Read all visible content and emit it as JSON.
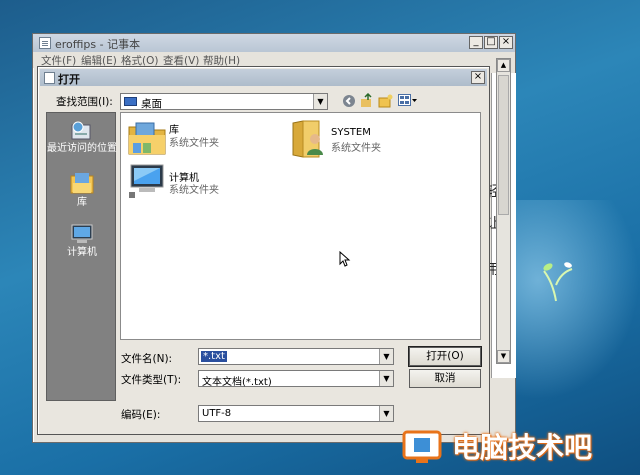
{
  "notepad": {
    "title": "eroffips - 记事本",
    "menu": [
      "文件(F)",
      "编辑(E)",
      "格式(O)",
      "查看(V)",
      "帮助(H)"
    ],
    "side_text": [
      "轻",
      "让",
      "用"
    ]
  },
  "dialog": {
    "title": "打开",
    "look_in_label": "查找范围(I):",
    "look_in_value": "桌面",
    "places": [
      {
        "label": "最近访问的位置",
        "icon": "recent-places-icon"
      },
      {
        "label": "库",
        "icon": "libraries-icon"
      },
      {
        "label": "计算机",
        "icon": "computer-icon"
      }
    ],
    "files": [
      {
        "name": "库",
        "type": "系统文件夹",
        "icon": "libraries-folder-icon"
      },
      {
        "name": "SYSTEM",
        "type": "系统文件夹",
        "icon": "user-folder-icon"
      },
      {
        "name": "计算机",
        "type": "系统文件夹",
        "icon": "computer-icon"
      }
    ],
    "filename_label": "文件名(N):",
    "filename_value": "*.txt",
    "filetype_label": "文件类型(T):",
    "filetype_value": "文本文档(*.txt)",
    "encoding_label": "编码(E):",
    "encoding_value": "UTF-8",
    "open_button": "打开(O)",
    "cancel_button": "取消"
  },
  "watermark": {
    "text": "电脑技术吧"
  },
  "colors": {
    "selection": "#2a4f9e",
    "places_bg": "#818181",
    "desktop": "#1f6c9f",
    "watermark_orange": "#e8731a"
  }
}
